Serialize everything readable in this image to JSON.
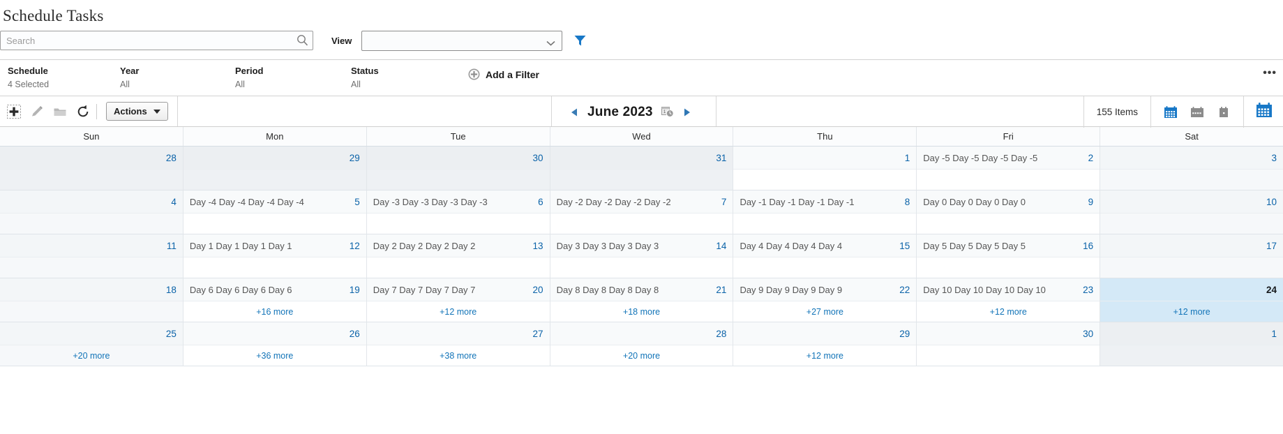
{
  "page": {
    "title": "Schedule Tasks"
  },
  "search": {
    "placeholder": "Search",
    "value": "",
    "icon": "search-icon"
  },
  "view": {
    "label": "View",
    "selected": "",
    "chevron_icon": "chevron-down-icon",
    "filter_icon": "funnel-icon"
  },
  "filters": {
    "columns": [
      {
        "label": "Schedule",
        "value": "4 Selected"
      },
      {
        "label": "Year",
        "value": "All"
      },
      {
        "label": "Period",
        "value": "All"
      },
      {
        "label": "Status",
        "value": "All"
      }
    ],
    "add_filter": {
      "label": "Add a Filter",
      "icon": "plus-circle-icon"
    },
    "overflow": {
      "label": "•••",
      "icon": "ellipsis-icon"
    }
  },
  "toolbar": {
    "icons": [
      {
        "name": "add-icon",
        "title": "Add"
      },
      {
        "name": "edit-pencil-icon",
        "title": "Edit"
      },
      {
        "name": "folder-icon",
        "title": "Folder"
      },
      {
        "name": "refresh-icon",
        "title": "Refresh"
      }
    ],
    "actions_label": "Actions",
    "prev_label": "◀",
    "next_label": "▶",
    "month_label": "June 2023",
    "month_icon": "calendar-clock-icon",
    "items_count": "155 Items",
    "view_icons": [
      {
        "name": "month-view-icon",
        "selected": true
      },
      {
        "name": "week-view-icon",
        "selected": false
      },
      {
        "name": "day-view-icon",
        "selected": false
      }
    ],
    "calendar_toggle_icon": "calendar-icon"
  },
  "calendar": {
    "day_headers": [
      "Sun",
      "Mon",
      "Tue",
      "Wed",
      "Thu",
      "Fri",
      "Sat"
    ],
    "weeks": [
      {
        "days": [
          {
            "num": "28",
            "text": "",
            "more": "",
            "othermonth": true,
            "weekend": true
          },
          {
            "num": "29",
            "text": "",
            "more": "",
            "othermonth": true
          },
          {
            "num": "30",
            "text": "",
            "more": "",
            "othermonth": true
          },
          {
            "num": "31",
            "text": "",
            "more": "",
            "othermonth": true
          },
          {
            "num": "1",
            "text": "",
            "more": ""
          },
          {
            "num": "2",
            "text": "Day -5 Day -5 Day -5 Day -5",
            "more": ""
          },
          {
            "num": "3",
            "text": "",
            "more": "",
            "weekend": true
          }
        ]
      },
      {
        "days": [
          {
            "num": "4",
            "text": "",
            "more": "",
            "weekend": true
          },
          {
            "num": "5",
            "text": "Day -4 Day -4 Day -4 Day -4",
            "more": ""
          },
          {
            "num": "6",
            "text": "Day -3 Day -3 Day -3 Day -3",
            "more": ""
          },
          {
            "num": "7",
            "text": "Day -2 Day -2 Day -2 Day -2",
            "more": ""
          },
          {
            "num": "8",
            "text": "Day -1 Day -1 Day -1 Day -1",
            "more": ""
          },
          {
            "num": "9",
            "text": "Day 0 Day 0 Day 0 Day 0",
            "more": ""
          },
          {
            "num": "10",
            "text": "",
            "more": "",
            "weekend": true
          }
        ]
      },
      {
        "days": [
          {
            "num": "11",
            "text": "",
            "more": "",
            "weekend": true
          },
          {
            "num": "12",
            "text": "Day 1 Day 1 Day 1 Day 1",
            "more": ""
          },
          {
            "num": "13",
            "text": "Day 2 Day 2 Day 2 Day 2",
            "more": ""
          },
          {
            "num": "14",
            "text": "Day 3 Day 3 Day 3 Day 3",
            "more": ""
          },
          {
            "num": "15",
            "text": "Day 4 Day 4 Day 4 Day 4",
            "more": ""
          },
          {
            "num": "16",
            "text": "Day 5 Day 5 Day 5 Day 5",
            "more": ""
          },
          {
            "num": "17",
            "text": "",
            "more": "",
            "weekend": true
          }
        ]
      },
      {
        "days": [
          {
            "num": "18",
            "text": "",
            "more": "",
            "weekend": true
          },
          {
            "num": "19",
            "text": "Day 6 Day 6 Day 6 Day 6",
            "more": "+16 more"
          },
          {
            "num": "20",
            "text": "Day 7 Day 7 Day 7 Day 7",
            "more": "+12 more"
          },
          {
            "num": "21",
            "text": "Day 8 Day 8 Day 8 Day 8",
            "more": "+18 more"
          },
          {
            "num": "22",
            "text": "Day 9 Day 9 Day 9 Day 9",
            "more": "+27 more"
          },
          {
            "num": "23",
            "text": "Day 10 Day 10 Day 10 Day 10",
            "more": "+12 more"
          },
          {
            "num": "24",
            "text": "",
            "more": "+12 more",
            "today": true,
            "weekend": true
          }
        ]
      },
      {
        "days": [
          {
            "num": "25",
            "text": "",
            "more": "+20 more",
            "weekend": true
          },
          {
            "num": "26",
            "text": "",
            "more": "+36 more"
          },
          {
            "num": "27",
            "text": "",
            "more": "+38 more"
          },
          {
            "num": "28",
            "text": "",
            "more": "+20 more"
          },
          {
            "num": "29",
            "text": "",
            "more": "+12 more"
          },
          {
            "num": "30",
            "text": "",
            "more": ""
          },
          {
            "num": "1",
            "text": "",
            "more": "",
            "othermonth": true,
            "weekend": true
          }
        ]
      }
    ]
  }
}
